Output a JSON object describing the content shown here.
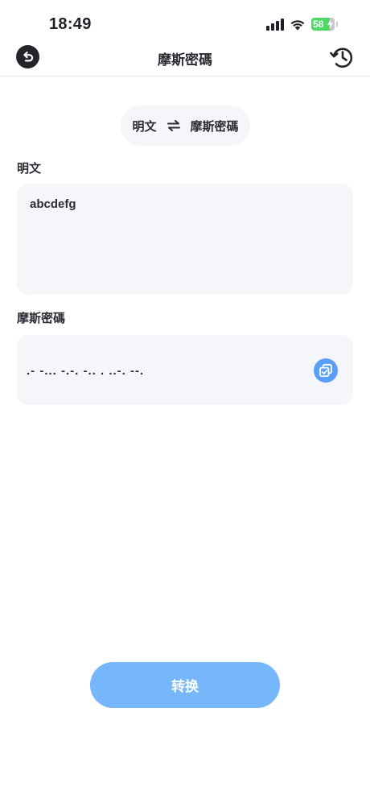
{
  "status_bar": {
    "time": "18:49",
    "battery_level": "58",
    "icons": [
      "signal-icon",
      "wifi-icon",
      "battery-icon",
      "charging-bolt-icon"
    ]
  },
  "nav": {
    "title": "摩斯密碼",
    "back_icon": "undo-arrow-icon",
    "history_icon": "history-clock-icon"
  },
  "swap": {
    "left_label": "明文",
    "right_label": "摩斯密碼",
    "icon": "swap-arrows-icon"
  },
  "plaintext_section": {
    "label": "明文",
    "value": "abcdefg"
  },
  "morse_section": {
    "label": "摩斯密碼",
    "value": ".- -... -.-. -.. . ..-. --.",
    "copy_icon": "copy-icon"
  },
  "convert_button": {
    "label": "转换"
  },
  "colors": {
    "primary_button": "#76b6fb",
    "copy_button": "#5a9ff5",
    "field_background": "#f5f6fa",
    "text": "#2a2c33"
  }
}
